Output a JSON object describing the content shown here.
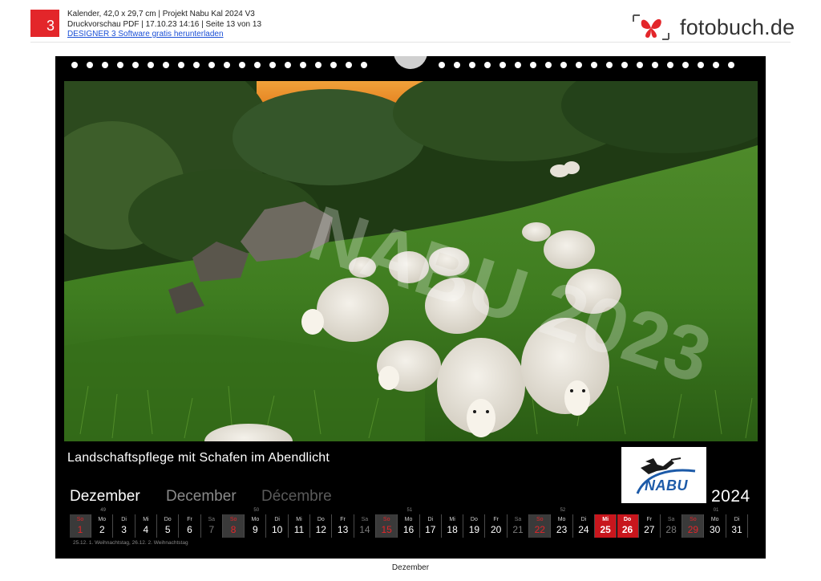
{
  "header": {
    "page_number": "3",
    "line1": "Kalender, 42,0 x 29,7 cm | Projekt Nabu Kal 2024 V3",
    "line2": "Druckvorschau PDF | 17.10.23 14:16 | Seite 13 von 13",
    "link": "DESIGNER 3 Software gratis herunterladen",
    "logo_text": "fotobuch.de",
    "logo_icon": "butterfly-icon"
  },
  "sheet": {
    "photo_watermark": "NABU 2023",
    "caption": "Landschaftspflege mit Schafen im Abendlicht",
    "org_logo": "NABU",
    "month_de": "Dezember",
    "month_en": "December",
    "month_fr": "Décembre",
    "year": "2024",
    "weeks": [
      {
        "label": "49"
      },
      {
        "label": "50"
      },
      {
        "label": "51"
      },
      {
        "label": "52"
      },
      {
        "label": "01"
      }
    ],
    "days": [
      {
        "n": "So",
        "d": "1",
        "t": "sun"
      },
      {
        "n": "Mo",
        "d": "2",
        "t": ""
      },
      {
        "n": "Di",
        "d": "3",
        "t": ""
      },
      {
        "n": "Mi",
        "d": "4",
        "t": ""
      },
      {
        "n": "Do",
        "d": "5",
        "t": ""
      },
      {
        "n": "Fr",
        "d": "6",
        "t": ""
      },
      {
        "n": "Sa",
        "d": "7",
        "t": "sat"
      },
      {
        "n": "So",
        "d": "8",
        "t": "sun"
      },
      {
        "n": "Mo",
        "d": "9",
        "t": ""
      },
      {
        "n": "Di",
        "d": "10",
        "t": ""
      },
      {
        "n": "Mi",
        "d": "11",
        "t": ""
      },
      {
        "n": "Do",
        "d": "12",
        "t": ""
      },
      {
        "n": "Fr",
        "d": "13",
        "t": ""
      },
      {
        "n": "Sa",
        "d": "14",
        "t": "sat"
      },
      {
        "n": "So",
        "d": "15",
        "t": "sun"
      },
      {
        "n": "Mo",
        "d": "16",
        "t": ""
      },
      {
        "n": "Di",
        "d": "17",
        "t": ""
      },
      {
        "n": "Mi",
        "d": "18",
        "t": ""
      },
      {
        "n": "Do",
        "d": "19",
        "t": ""
      },
      {
        "n": "Fr",
        "d": "20",
        "t": ""
      },
      {
        "n": "Sa",
        "d": "21",
        "t": "sat"
      },
      {
        "n": "So",
        "d": "22",
        "t": "sun"
      },
      {
        "n": "Mo",
        "d": "23",
        "t": ""
      },
      {
        "n": "Di",
        "d": "24",
        "t": ""
      },
      {
        "n": "Mi",
        "d": "25",
        "t": "hol"
      },
      {
        "n": "Do",
        "d": "26",
        "t": "hol"
      },
      {
        "n": "Fr",
        "d": "27",
        "t": ""
      },
      {
        "n": "Sa",
        "d": "28",
        "t": "sat"
      },
      {
        "n": "So",
        "d": "29",
        "t": "sun"
      },
      {
        "n": "Mo",
        "d": "30",
        "t": ""
      },
      {
        "n": "Di",
        "d": "31",
        "t": ""
      }
    ],
    "holidays_note": "25.12. 1. Weihnachtstag, 26.12. 2. Weihnachtstag"
  },
  "footer": {
    "label": "Dezember"
  }
}
